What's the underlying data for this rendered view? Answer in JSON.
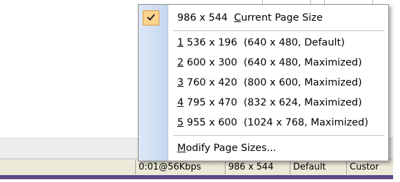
{
  "menu": {
    "current": {
      "size": "986 x 544",
      "label": "Current Page Size",
      "accel": "C"
    },
    "items": [
      {
        "num": "1",
        "size": "536 x 196",
        "desc": "(640 x 480, Default)"
      },
      {
        "num": "2",
        "size": "600 x 300",
        "desc": "(640 x 480, Maximized)"
      },
      {
        "num": "3",
        "size": "760 x 420",
        "desc": "(800 x 600, Maximized)"
      },
      {
        "num": "4",
        "size": "795 x 470",
        "desc": "(832 x 624, Maximized)"
      },
      {
        "num": "5",
        "size": "955 x 600",
        "desc": "(1024 x 768, Maximized)"
      }
    ],
    "modify": {
      "accel": "M",
      "rest": "odify Page Sizes..."
    }
  },
  "status": {
    "time": "0:01@56Kbps",
    "size": "986 x 544",
    "mode": "Default",
    "custom": "Custor"
  },
  "colors": {
    "check_bg": "#fbd38c",
    "gutter": "#d4e2f4",
    "status_bg": "#ece9d8"
  }
}
